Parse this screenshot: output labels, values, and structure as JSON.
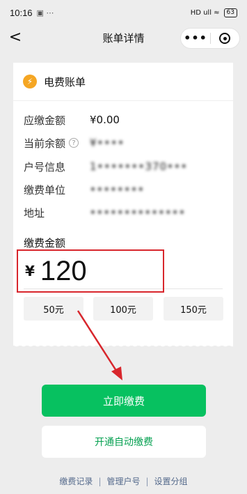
{
  "statusbar": {
    "time": "10:16",
    "indicators": "▣ ⋯",
    "signal": "HD ull ≈",
    "battery": "63"
  },
  "navbar": {
    "back": "<",
    "title": "账单详情",
    "more": "•••"
  },
  "card": {
    "title": "电费账单",
    "rows": [
      {
        "label": "应缴金额",
        "value": "¥0.00"
      },
      {
        "label": "当前余额",
        "value": "¥••••"
      },
      {
        "label": "户号信息",
        "value": "1•••••••370•••"
      },
      {
        "label": "缴费单位",
        "value": "••••••••"
      },
      {
        "label": "地址",
        "value": "••••••••••••••"
      }
    ],
    "pay_label": "缴费金额",
    "currency": "¥",
    "amount": "120",
    "options": [
      "50元",
      "100元",
      "150元"
    ]
  },
  "buttons": {
    "pay_now": "立即缴费",
    "auto_pay": "开通自动缴费"
  },
  "footer": {
    "links": [
      "缴费记录",
      "管理户号",
      "设置分组"
    ],
    "divider": "|"
  },
  "colors": {
    "primary": "#07c160",
    "highlight": "#d8262c",
    "bolt": "#f5a623"
  }
}
